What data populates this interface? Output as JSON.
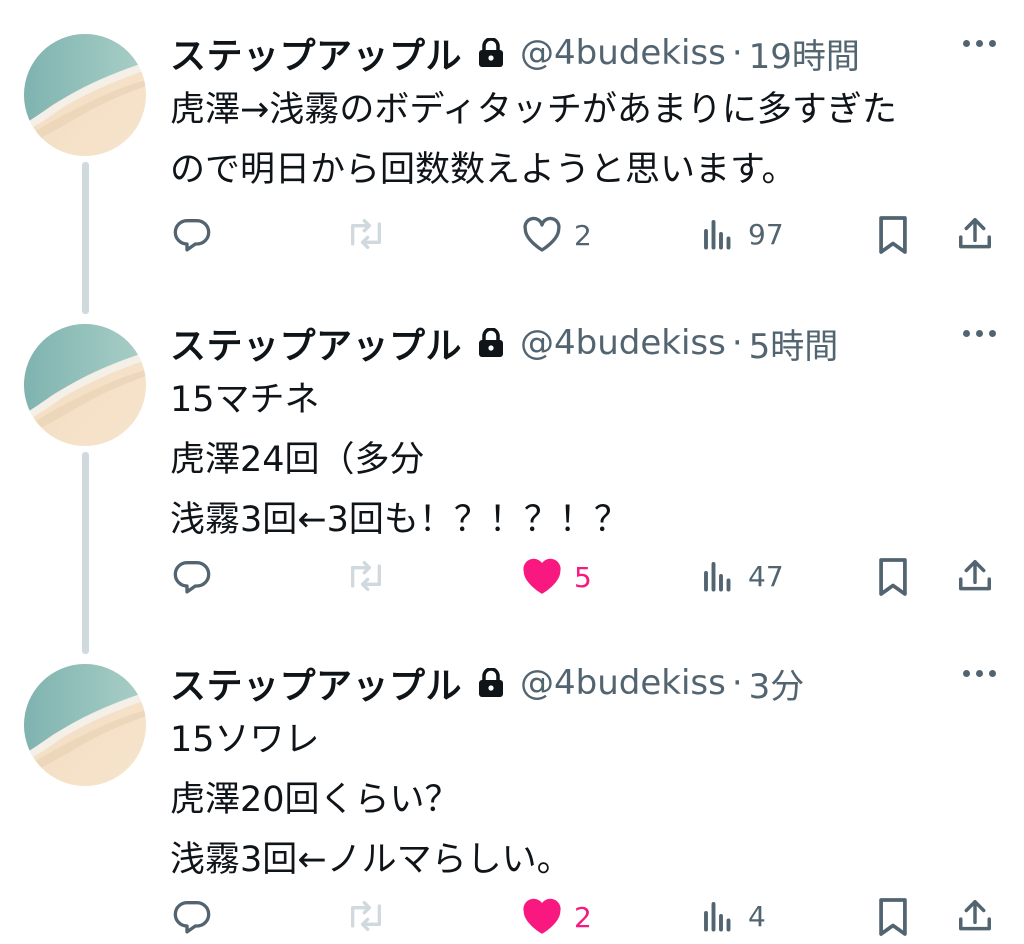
{
  "colors": {
    "text": "#0f1419",
    "muted": "#536471",
    "like": "#f91880",
    "thread_line": "#cfd9de",
    "retweet_disabled": "#cfd9de"
  },
  "tweets": [
    {
      "name": "ステップアップル",
      "handle": "@4budekiss",
      "separator": "·",
      "time": "19時間",
      "lines": [
        "虎澤→浅霧のボディタッチがあまりに多すぎた",
        "ので明日から回数数えようと思います。"
      ],
      "likes": "2",
      "liked": false,
      "views": "97"
    },
    {
      "name": "ステップアップル",
      "handle": "@4budekiss",
      "separator": "·",
      "time": "5時間",
      "lines": [
        "15マチネ",
        "虎澤24回（多分",
        "浅霧3回←3回も！？！？！？"
      ],
      "likes": "5",
      "liked": true,
      "views": "47"
    },
    {
      "name": "ステップアップル",
      "handle": "@4budekiss",
      "separator": "·",
      "time": "3分",
      "lines": [
        "15ソワレ",
        "虎澤20回くらい？",
        "浅霧3回←ノルマらしい。"
      ],
      "likes": "2",
      "liked": true,
      "views": "4"
    }
  ]
}
